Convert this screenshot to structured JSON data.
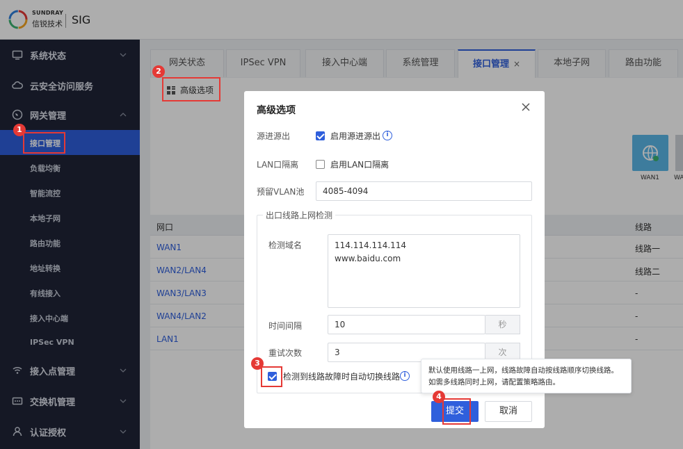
{
  "header": {
    "brand_en": "SUNDRAY",
    "brand_cn": "信锐技术",
    "product": "SIG"
  },
  "sidebar": {
    "groups": [
      {
        "label": "系统状态",
        "icon": "monitor-icon"
      },
      {
        "label": "云安全访问服务",
        "icon": "cloud-icon"
      },
      {
        "label": "网关管理",
        "icon": "globe-icon"
      }
    ],
    "sub_items": [
      "接口管理",
      "负载均衡",
      "智能流控",
      "本地子网",
      "路由功能",
      "地址转换",
      "有线接入",
      "接入中心端",
      "IPSec VPN"
    ],
    "bottom_groups": [
      {
        "label": "接入点管理",
        "icon": "wifi-icon"
      },
      {
        "label": "交换机管理",
        "icon": "switch-icon"
      },
      {
        "label": "认证授权",
        "icon": "user-icon"
      }
    ]
  },
  "tabs": [
    "网关状态",
    "IPSec VPN",
    "接入中心端",
    "系统管理",
    "接口管理",
    "本地子网",
    "路由功能"
  ],
  "toolbar": {
    "advanced_label": "高级选项"
  },
  "devices": [
    "WAN1",
    "WA"
  ],
  "table": {
    "headers": [
      "网口",
      "线路"
    ],
    "rows": [
      {
        "port": "WAN1",
        "line": "线路一"
      },
      {
        "port": "WAN2/LAN4",
        "line": "线路二"
      },
      {
        "port": "WAN3/LAN3",
        "line": "-"
      },
      {
        "port": "WAN4/LAN2",
        "line": "-"
      },
      {
        "port": "LAN1",
        "line": "-"
      }
    ]
  },
  "dialog": {
    "title": "高级选项",
    "src_in_out_label": "源进源出",
    "src_in_out_checkbox": "启用源进源出",
    "lan_isolation_label": "LAN口隔离",
    "lan_isolation_checkbox": "启用LAN口隔离",
    "vlan_pool_label": "预留VLAN池",
    "vlan_pool_value": "4085-4094",
    "fieldset_legend": "出口线路上网检测",
    "detect_domain_label": "检测域名",
    "detect_domains": [
      "114.114.114.114",
      "www.baidu.com"
    ],
    "interval_label": "时间间隔",
    "interval_value": "10",
    "interval_unit": "秒",
    "retry_label": "重试次数",
    "retry_value": "3",
    "retry_unit": "次",
    "auto_switch_label": "检测到线路故障时自动切换线路",
    "submit_label": "提交",
    "cancel_label": "取消"
  },
  "tooltip": {
    "line1": "默认使用线路一上网，线路故障自动按线路顺序切换线路。",
    "line2": "如需多线路同时上网，请配置策略路由。"
  },
  "steps": [
    "1",
    "2",
    "3",
    "4"
  ],
  "colors": {
    "accent": "#2f5fdc",
    "sidebar_bg": "#1f2437",
    "highlight": "#e53935"
  }
}
